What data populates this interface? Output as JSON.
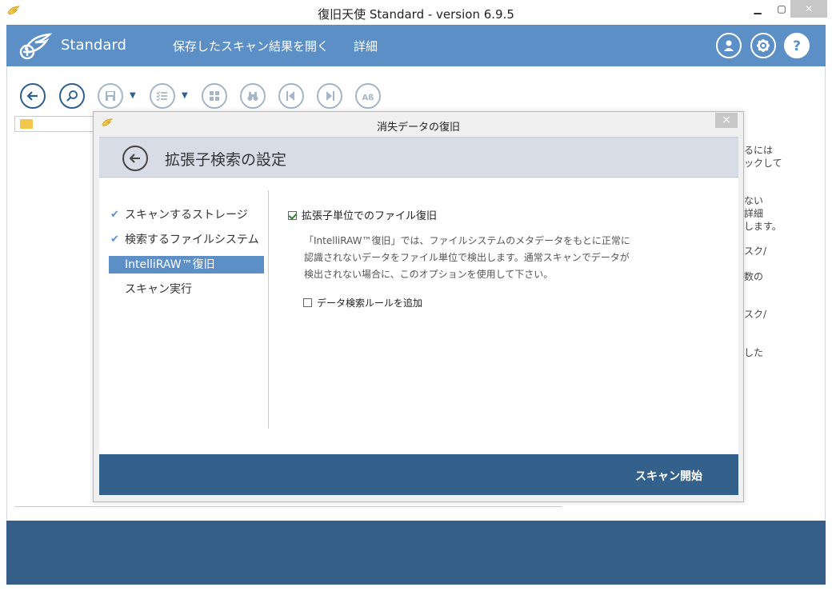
{
  "window": {
    "title": "復旧天使 Standard - version 6.9.5",
    "minimize_icon": "minimize-icon",
    "maximize_icon": "maximize-icon",
    "close_label": "✕"
  },
  "appbar": {
    "brand": "Standard",
    "menu": [
      "保存したスキャン結果を開く",
      "詳細"
    ],
    "icons": [
      "user-icon",
      "gear-icon",
      "help-icon"
    ],
    "accent": "#5b8fc6"
  },
  "toolbar": {
    "icons": [
      "back-icon",
      "search-icon",
      "save-icon",
      "list-icon",
      "grid-icon",
      "binoculars-icon",
      "prev-icon",
      "next-icon",
      "text-search-icon"
    ]
  },
  "background_text": [
    "るには",
    "ックして",
    "ない",
    "詳細",
    "します。",
    "スク/",
    "数の",
    "スク/",
    "した"
  ],
  "dialog": {
    "title": "消失データの復旧",
    "close_label": "×",
    "header_title": "拡張子検索の設定",
    "steps": [
      {
        "label": "スキャンするストレージ",
        "done": true
      },
      {
        "label": "検索するファイルシステム",
        "done": true
      },
      {
        "label": "IntelliRAW™復旧",
        "active": true
      },
      {
        "label": "スキャン実行"
      }
    ],
    "main_option": {
      "label": "拡張子単位でのファイル復旧",
      "checked": true
    },
    "description": [
      "「IntelliRAW™復旧」では、ファイルシステムのメタデータをもとに正常に",
      "認識されないデータをファイル単位で検出します。通常スキャンでデータが",
      "検出されない場合に、このオプションを使用して下さい。"
    ],
    "sub_option": {
      "label": "データ検索ルールを追加",
      "checked": false
    },
    "start_button": "スキャン開始",
    "footer_color": "#33618c"
  }
}
